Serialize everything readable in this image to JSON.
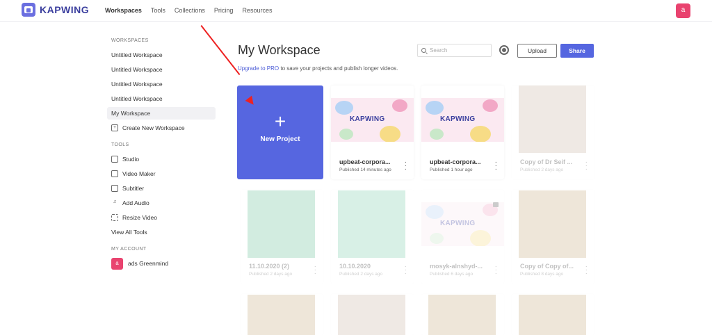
{
  "brand": {
    "name": "KAPWING"
  },
  "nav": {
    "items": [
      "Workspaces",
      "Tools",
      "Collections",
      "Pricing",
      "Resources"
    ]
  },
  "user": {
    "initial": "a",
    "name": "ads Greenmind"
  },
  "sidebar": {
    "workspaces_title": "WORKSPACES",
    "workspaces": [
      "Untitled Workspace",
      "Untitled Workspace",
      "Untitled Workspace",
      "Untitled Workspace",
      "My Workspace"
    ],
    "create": "Create New Workspace",
    "tools_title": "TOOLS",
    "tools": [
      "Studio",
      "Video Maker",
      "Subtitler",
      "Add Audio",
      "Resize Video",
      "View All Tools"
    ],
    "account_title": "MY ACCOUNT"
  },
  "main": {
    "title": "My Workspace",
    "upgrade_link": "Upgrade to PRO",
    "upgrade_text": " to save your projects and publish longer videos.",
    "search_placeholder": "Search",
    "upload": "Upload",
    "share": "Share",
    "new_project": "New Project",
    "plus": "+"
  },
  "projects": [
    {
      "title": "upbeat-corpora...",
      "sub": "Published 14 minutes ago"
    },
    {
      "title": "upbeat-corpora...",
      "sub": "Published 1 hour ago"
    },
    {
      "title": "Copy of Dr Seif ...",
      "sub": "Published 2 days ago"
    },
    {
      "title": "11.10.2020 (2)",
      "sub": "Published 2 days ago"
    },
    {
      "title": "10.10.2020",
      "sub": "Published 2 days ago"
    },
    {
      "title": "mosyk-alnshyd-...",
      "sub": "Published 6 days ago"
    },
    {
      "title": "Copy of Copy of...",
      "sub": "Published 8 days ago"
    }
  ],
  "colors": {
    "accent": "#5666e0",
    "avatar": "#e9436f",
    "arrow": "#e22222"
  }
}
